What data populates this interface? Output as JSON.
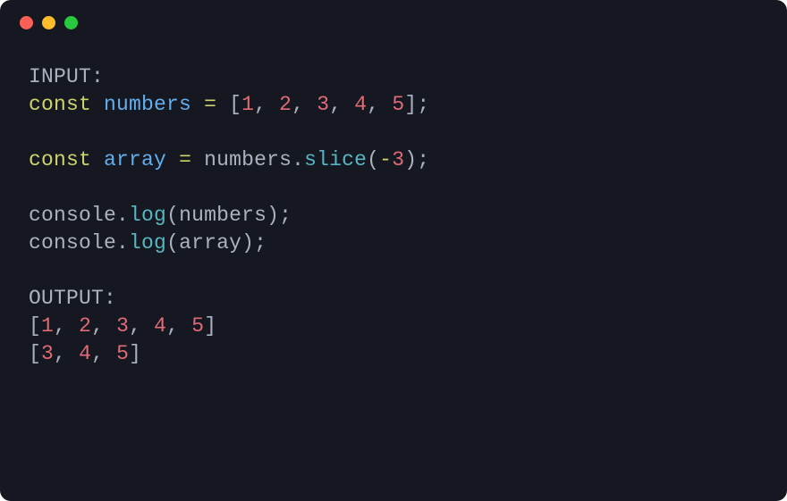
{
  "window": {
    "dots": [
      "red",
      "yellow",
      "green"
    ]
  },
  "code": {
    "line1_label": "INPUT:",
    "line2": {
      "kw": "const",
      "ident": "numbers",
      "eq": "=",
      "l": "[",
      "n1": "1",
      "c": ",",
      "sp": " ",
      "n2": "2",
      "n3": "3",
      "n4": "4",
      "n5": "5",
      "r": "];"
    },
    "line4": {
      "kw": "const",
      "ident": "array",
      "eq": "=",
      "obj": "numbers",
      "dot": ".",
      "method": "slice",
      "l": "(",
      "arg_prefix": "-",
      "arg": "3",
      "r": ");"
    },
    "line6": {
      "obj": "console",
      "dot": ".",
      "method": "log",
      "l": "(",
      "arg": "numbers",
      "r": ");"
    },
    "line7": {
      "obj": "console",
      "dot": ".",
      "method": "log",
      "l": "(",
      "arg": "array",
      "r": ");"
    },
    "line9_label": "OUTPUT:",
    "line10": {
      "l": "[",
      "n1": "1",
      "c": ",",
      "sp": " ",
      "n2": "2",
      "n3": "3",
      "n4": "4",
      "n5": "5",
      "r": "]"
    },
    "line11": {
      "l": "[",
      "n1": "3",
      "c": ",",
      "sp": " ",
      "n2": "4",
      "n3": "5",
      "r": "]"
    }
  }
}
